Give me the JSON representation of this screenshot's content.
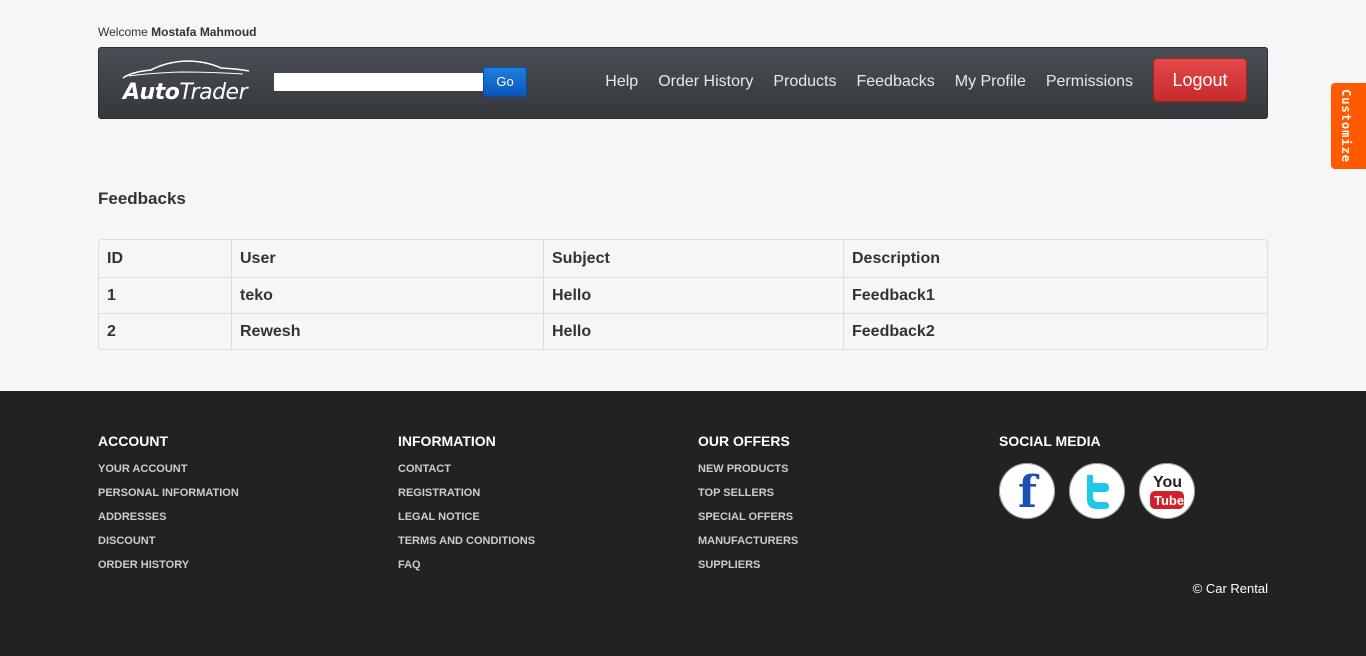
{
  "header": {
    "welcome_prefix": "Welcome",
    "user_name": "Mostafa Mahmoud",
    "logo_bold": "Auto",
    "logo_light": "Trader",
    "search_value": "",
    "go_label": "Go",
    "nav": [
      "Help",
      "Order History",
      "Products",
      "Feedbacks",
      "My Profile",
      "Permissions"
    ],
    "logout_label": "Logout"
  },
  "customize_label": "Customize",
  "main": {
    "title": "Feedbacks",
    "columns": [
      "ID",
      "User",
      "Subject",
      "Description"
    ],
    "rows": [
      [
        "1",
        "teko",
        "Hello",
        "Feedback1"
      ],
      [
        "2",
        "Rewesh",
        "Hello",
        "Feedback2"
      ]
    ]
  },
  "footer": {
    "account": {
      "title": "ACCOUNT",
      "items": [
        "YOUR ACCOUNT",
        "PERSONAL INFORMATION",
        "ADDRESSES",
        "DISCOUNT",
        "ORDER HISTORY"
      ]
    },
    "information": {
      "title": "INFORMATION",
      "items": [
        "CONTACT",
        "REGISTRATION",
        "LEGAL NOTICE",
        "TERMS AND CONDITIONS",
        "FAQ"
      ]
    },
    "offers": {
      "title": "OUR OFFERS",
      "items": [
        "NEW PRODUCTS",
        "TOP SELLERS",
        "SPECIAL OFFERS",
        "MANUFACTURERS",
        "SUPPLIERS"
      ]
    },
    "social": {
      "title": "SOCIAL MEDIA",
      "icons": [
        "facebook-icon",
        "twitter-icon",
        "youtube-icon"
      ]
    },
    "copyright": "© Car Rental"
  },
  "colors": {
    "navbar": "#3e4247",
    "go_button": "#0a56b8",
    "logout_button": "#d33333",
    "customize_tab": "#ff5a00",
    "footer": "#222222"
  }
}
